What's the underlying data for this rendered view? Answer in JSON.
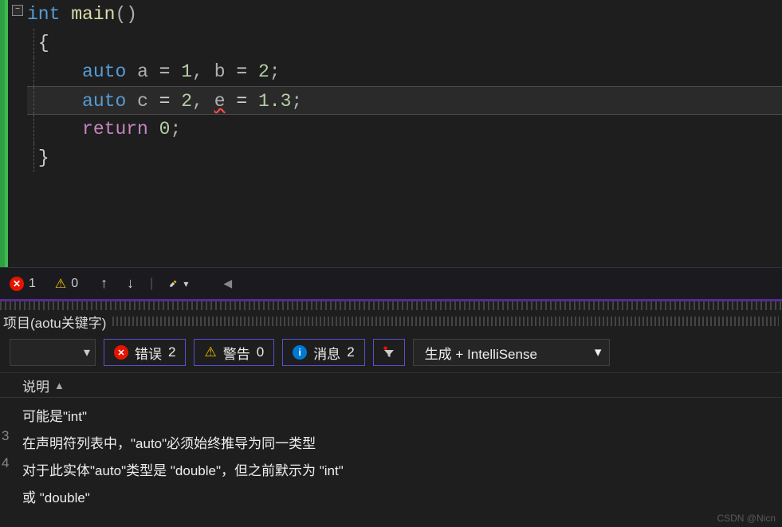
{
  "code": {
    "line1": {
      "type": "int",
      "func": "main",
      "paren_open": "(",
      "paren_close": ")"
    },
    "line2": "{",
    "line3": {
      "indent": "    ",
      "kw": "auto",
      "v1": "a",
      "eq1": " = ",
      "n1": "1",
      "c1": ",",
      "sp": " ",
      "v2": "b",
      "eq2": " = ",
      "n2": "2",
      "semi": ";"
    },
    "line4": {
      "indent": "    ",
      "kw": "auto",
      "v1": "c",
      "eq1": " = ",
      "n1": "2",
      "c1": ",",
      "sp": " ",
      "v2": "e",
      "eq2": " = ",
      "n2": "1.3",
      "semi": ";"
    },
    "line5": {
      "indent": "    ",
      "kw": "return",
      "sp": " ",
      "n": "0",
      "semi": ";"
    },
    "line6": "}"
  },
  "status": {
    "error_count": "1",
    "warning_count": "0"
  },
  "panel": {
    "title": "项目(aotu关键字)"
  },
  "filters": {
    "errors_label": "错误",
    "errors_count": "2",
    "warnings_label": "警告",
    "warnings_count": "0",
    "messages_label": "消息",
    "messages_count": "2",
    "build_source": "生成 + IntelliSense"
  },
  "table": {
    "desc_header": "说明"
  },
  "messages": [
    {
      "idx": "",
      "text": "可能是\"int\""
    },
    {
      "idx": "3",
      "text": "在声明符列表中，\"auto\"必须始终推导为同一类型"
    },
    {
      "idx": "4",
      "text": "对于此实体\"auto\"类型是 \"double\"，但之前默示为 \"int\""
    },
    {
      "idx": "",
      "text": "或    \"double\""
    }
  ],
  "watermark": "CSDN @Nicn"
}
